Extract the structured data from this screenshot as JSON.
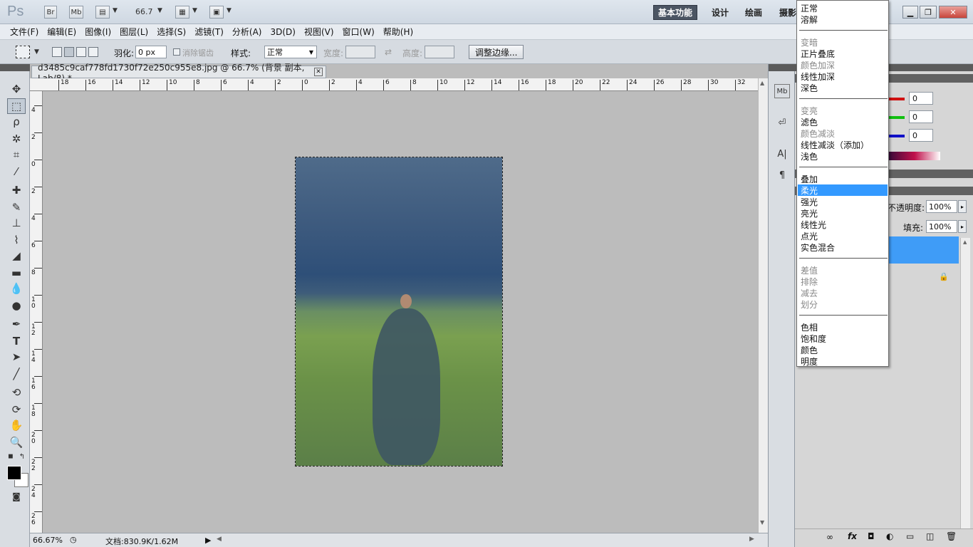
{
  "titlebar": {
    "br_label": "Br",
    "mb_label": "Mb",
    "zoom": "66.7",
    "workspaces": [
      "基本功能",
      "设计",
      "绘画",
      "摄影"
    ]
  },
  "menu": [
    "文件(F)",
    "编辑(E)",
    "图像(I)",
    "图层(L)",
    "选择(S)",
    "滤镜(T)",
    "分析(A)",
    "3D(D)",
    "视图(V)",
    "窗口(W)",
    "帮助(H)"
  ],
  "options": {
    "feather_label": "羽化:",
    "feather_value": "0 px",
    "antialias_label": "消除锯齿",
    "style_label": "样式:",
    "style_value": "正常",
    "width_label": "宽度:",
    "height_label": "高度:",
    "refine_edge": "调整边缘..."
  },
  "document": {
    "tab_title": "d3485c9caf778fd1730f72e250c955e8.jpg @ 66.7% (背景 副本, Lab/8) *",
    "zoom_status": "66.67%",
    "doc_info": "文档:830.9K/1.62M",
    "ruler_top": [
      "18",
      "16",
      "14",
      "12",
      "10",
      "8",
      "6",
      "4",
      "2",
      "0",
      "2",
      "4",
      "6",
      "8",
      "10",
      "12",
      "14",
      "16",
      "18",
      "20",
      "22",
      "24",
      "26",
      "28",
      "30",
      "32"
    ],
    "ruler_left": [
      "4",
      "2",
      "0",
      "2",
      "4",
      "6",
      "8",
      "10",
      "12",
      "14",
      "16",
      "18",
      "20",
      "22",
      "24",
      "26"
    ]
  },
  "panels": {
    "color_values": [
      "0",
      "0",
      "0"
    ],
    "opacity_label": "不透明度:",
    "opacity_value": "100%",
    "fill_label": "填充:",
    "fill_value": "100%"
  },
  "blend_menu": {
    "groups": [
      [
        "正常",
        "溶解"
      ],
      [
        "变暗",
        "正片叠底",
        "颜色加深",
        "线性加深",
        "深色"
      ],
      [
        "变亮",
        "滤色",
        "颜色减淡",
        "线性减淡（添加）",
        "浅色"
      ],
      [
        "叠加",
        "柔光",
        "强光",
        "亮光",
        "线性光",
        "点光",
        "实色混合"
      ],
      [
        "差值",
        "排除",
        "减去",
        "划分"
      ],
      [
        "色相",
        "饱和度",
        "颜色",
        "明度"
      ]
    ],
    "selected": "柔光",
    "disabled": [
      "变暗",
      "颜色加深",
      "变亮",
      "颜色减淡",
      "差值",
      "排除",
      "减去",
      "划分"
    ]
  },
  "colors": {
    "selection_blue": "#3399ff",
    "layer_highlight": "#3f9cf7",
    "red_channel": "#d01010",
    "green_channel": "#10c010",
    "blue_channel": "#1010c8"
  }
}
